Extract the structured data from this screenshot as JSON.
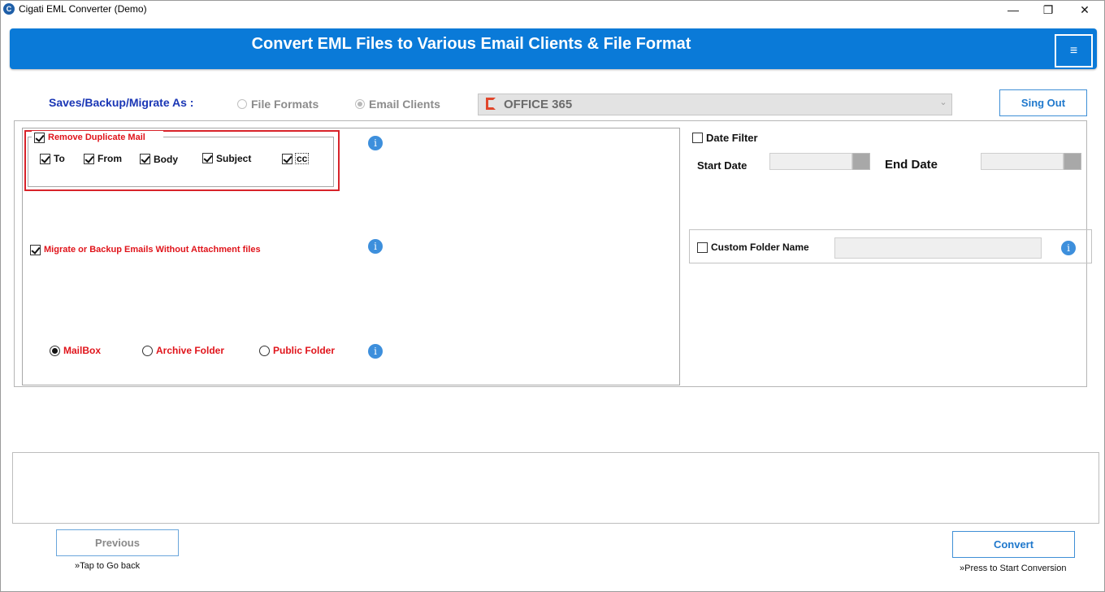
{
  "window": {
    "title": "Cigati EML Converter (Demo)",
    "app_icon": "app-logo-icon",
    "app_icon_glyph": "C",
    "minimize": "—",
    "maximize": "❐",
    "close": "✕"
  },
  "banner": {
    "title": "Convert EML Files to Various Email Clients & File Format",
    "menu_glyph": "≡"
  },
  "saves": {
    "label": "Saves/Backup/Migrate As :",
    "option_file_formats": "File Formats",
    "option_email_clients": "Email Clients",
    "selected_option": "Email Clients",
    "target_value": "OFFICE 365",
    "dropdown_arrow": "⌄"
  },
  "signout": {
    "label": "Sing Out"
  },
  "duplicate": {
    "label": "Remove Duplicate Mail",
    "checked": true,
    "fields": [
      {
        "label": "To",
        "checked": true
      },
      {
        "label": "From",
        "checked": true
      },
      {
        "label": "Body",
        "checked": true
      },
      {
        "label": "Subject",
        "checked": true
      },
      {
        "label": "cc",
        "checked": true
      }
    ]
  },
  "without_attachments": {
    "label": "Migrate or Backup Emails Without Attachment files",
    "checked": true
  },
  "mailbox_type": {
    "options": [
      "MailBox",
      "Archive Folder",
      "Public Folder"
    ],
    "selected": "MailBox"
  },
  "info_glyph": "i",
  "date_filter": {
    "label": "Date Filter",
    "checked": false,
    "start_label": "Start Date",
    "end_label": "End Date",
    "start_value": "",
    "end_value": ""
  },
  "custom_folder": {
    "label": "Custom Folder Name",
    "checked": false,
    "value": ""
  },
  "footer": {
    "previous_label": "Previous",
    "previous_hint": "»Tap to Go back",
    "convert_label": "Convert",
    "convert_hint": "»Press to Start Conversion"
  },
  "colors": {
    "banner": "#0a7ad8",
    "accent_text": "#1a36b5",
    "warning_red": "#e0141b",
    "button_border": "#3f8fd6"
  }
}
